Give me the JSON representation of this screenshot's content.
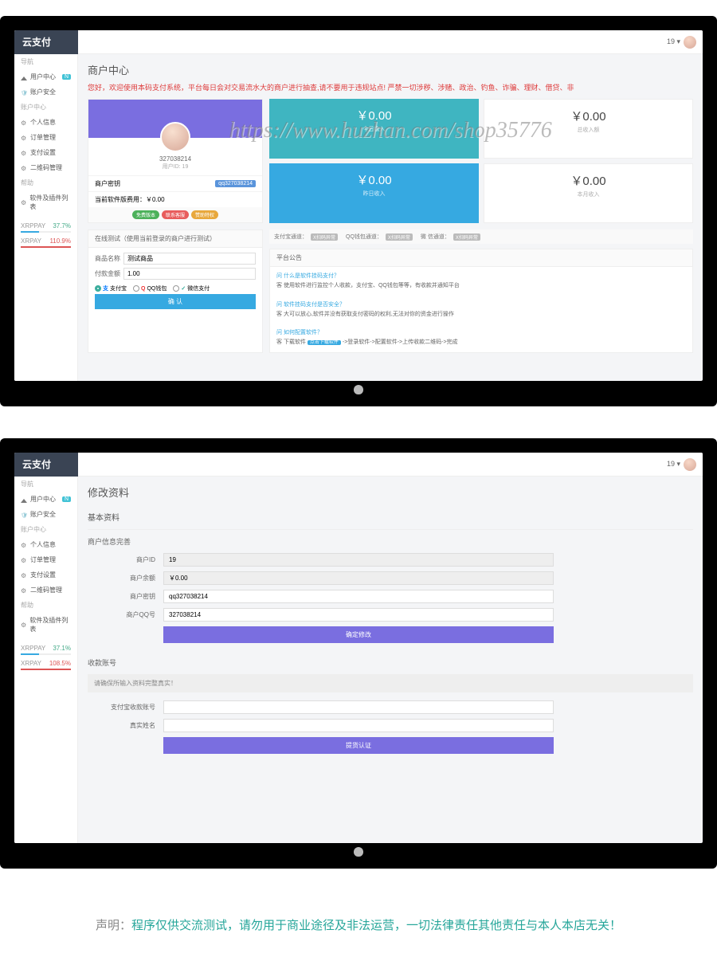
{
  "brand": "云支付",
  "topbar_uid": "19 ▾",
  "watermark": "https://www.huzhan.com/shop35776",
  "sidebar": {
    "sections": [
      {
        "title": "导航",
        "items": [
          {
            "icon": "home-icon",
            "label": "用户中心",
            "badge": "N"
          },
          {
            "icon": "shield-icon",
            "label": "账户安全"
          }
        ]
      },
      {
        "title": "账户中心",
        "items": [
          {
            "icon": "gear-icon",
            "label": "个人信息"
          },
          {
            "icon": "gear-icon",
            "label": "订单管理"
          },
          {
            "icon": "gear-icon",
            "label": "支付设置"
          },
          {
            "icon": "gear-icon",
            "label": "二维码管理"
          }
        ]
      },
      {
        "title": "帮助",
        "items": [
          {
            "icon": "gear-icon",
            "label": "软件及插件列表"
          }
        ]
      }
    ],
    "stats1": [
      {
        "label": "XRPPAY",
        "value": "37.7%"
      },
      {
        "label": "XRPAY",
        "value": "110.9%",
        "warn": true
      }
    ],
    "stats2": [
      {
        "label": "XRPPAY",
        "value": "37.1%"
      },
      {
        "label": "XRPAY",
        "value": "108.5%",
        "warn": true
      }
    ]
  },
  "screen1": {
    "title": "商户中心",
    "notice": "您好，欢迎使用本码支付系统，平台每日会对交易流水大的商户进行抽查,请不要用于违规站点! 严禁一切涉秽、涉赌、政治、钓鱼、诈骗、理财、借贷、非",
    "profile": {
      "id": "327038214",
      "sub": "用户ID: 19",
      "row1_label": "商户密钥",
      "row1_value": "qq327038214",
      "row2_label": "当前软件版费用：",
      "row2_value": "￥0.00",
      "pills": [
        "免费版本",
        "联系客服",
        "赞助特权"
      ]
    },
    "stats": [
      {
        "value": "￥0.00",
        "label": "今日收入",
        "color": "teal"
      },
      {
        "value": "￥0.00",
        "label": "总收入额",
        "color": "white"
      },
      {
        "value": "￥0.00",
        "label": "昨日收入",
        "color": "blue"
      },
      {
        "value": "￥0.00",
        "label": "本月收入",
        "color": "white"
      }
    ],
    "test": {
      "header": "在线测试（使用当前登录的商户进行测试）",
      "name_label": "商品名称",
      "name_value": "测试商品",
      "amount_label": "付款金额",
      "amount_value": "1.00",
      "methods": [
        "支付宝",
        "QQ钱包",
        "微信支付"
      ],
      "confirm": "确 认"
    },
    "status_row": [
      {
        "label": "支付宝通道：",
        "badge": "X扫码异常"
      },
      {
        "label": "QQ钱包通道：",
        "badge": "X扫码异常"
      },
      {
        "label": "微 信通道：",
        "badge": "X扫码异常"
      }
    ],
    "announce": {
      "header": "平台公告",
      "q1": "问 什么是软件挂码支付？",
      "a1": "客 使用软件进行监控个人收款，支付宝、QQ钱包等等，有收款并通知平台",
      "q2": "问 软件挂码支付是否安全？",
      "a2": "客 大可以放心,软件并没有获取支付密码的权利,无法对你的资金进行操作",
      "q3": "问 如何配置软件？",
      "a3_prefix": "客 下载软件",
      "a3_link": "点击下载软件",
      "a3_suffix": "->登录软件->配置软件->上传收款二维码->完成"
    }
  },
  "screen2": {
    "title": "修改资料",
    "section1": "基本资料",
    "sub1": "商户信息完善",
    "fields1": [
      {
        "label": "商户ID",
        "value": "19",
        "readonly": true
      },
      {
        "label": "商户余额",
        "value": "￥0.00",
        "readonly": true
      },
      {
        "label": "商户密钥",
        "value": "qq327038214"
      },
      {
        "label": "商户QQ号",
        "value": "327038214"
      }
    ],
    "submit1": "确定修改",
    "section2": "收款账号",
    "alert": "请确保所输入资料完整真实！",
    "fields2": [
      {
        "label": "支付宝收款账号",
        "value": ""
      },
      {
        "label": "真实姓名",
        "value": ""
      }
    ],
    "submit2": "提货认证"
  },
  "disclaimer_label": "声明：",
  "disclaimer": "程序仅供交流测试，请勿用于商业途径及非法运营，一切法律责任其他责任与本人本店无关！"
}
